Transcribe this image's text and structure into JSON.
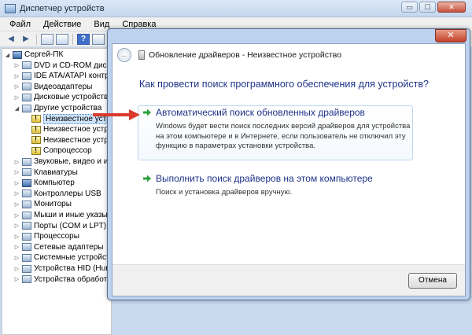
{
  "device_manager": {
    "title": "Диспетчер устройств",
    "window_buttons": [
      "▭",
      "☐",
      "✕"
    ],
    "menu": [
      "Файл",
      "Действие",
      "Вид",
      "Справка"
    ],
    "tree": [
      {
        "label": "Сергей-ПК",
        "expander": "◢",
        "icon": "computer-icon",
        "indent": 0
      },
      {
        "label": "DVD и CD-ROM дисководы",
        "expander": "▷",
        "icon": "dvd-icon",
        "indent": 1
      },
      {
        "label": "IDE ATA/ATAPI контроллеры",
        "expander": "▷",
        "icon": "ide-controller-icon",
        "indent": 1
      },
      {
        "label": "Видеоадаптеры",
        "expander": "▷",
        "icon": "display-adapter-icon",
        "indent": 1
      },
      {
        "label": "Дисковые устройства",
        "expander": "▷",
        "icon": "disk-drive-icon",
        "indent": 1
      },
      {
        "label": "Другие устройства",
        "expander": "◢",
        "icon": "other-devices-icon",
        "indent": 1
      },
      {
        "label": "Неизвестное устройство",
        "expander": "",
        "icon": "warning-device-icon",
        "indent": 2,
        "selected": true
      },
      {
        "label": "Неизвестное устройство",
        "expander": "",
        "icon": "warning-device-icon",
        "indent": 2
      },
      {
        "label": "Неизвестное устройство",
        "expander": "",
        "icon": "warning-device-icon",
        "indent": 2
      },
      {
        "label": "Сопроцессор",
        "expander": "",
        "icon": "warning-device-icon",
        "indent": 2
      },
      {
        "label": "Звуковые, видео и игровые устройства",
        "expander": "▷",
        "icon": "sound-icon",
        "indent": 1
      },
      {
        "label": "Клавиатуры",
        "expander": "▷",
        "icon": "keyboard-icon",
        "indent": 1
      },
      {
        "label": "Компьютер",
        "expander": "▷",
        "icon": "computer-icon",
        "indent": 1
      },
      {
        "label": "Контроллеры USB",
        "expander": "▷",
        "icon": "usb-icon",
        "indent": 1
      },
      {
        "label": "Мониторы",
        "expander": "▷",
        "icon": "monitor-icon",
        "indent": 1
      },
      {
        "label": "Мыши и иные указывающие устройства",
        "expander": "▷",
        "icon": "mouse-icon",
        "indent": 1
      },
      {
        "label": "Порты (COM и LPT)",
        "expander": "▷",
        "icon": "port-icon",
        "indent": 1
      },
      {
        "label": "Процессоры",
        "expander": "▷",
        "icon": "processor-icon",
        "indent": 1
      },
      {
        "label": "Сетевые адаптеры",
        "expander": "▷",
        "icon": "network-adapter-icon",
        "indent": 1
      },
      {
        "label": "Системные устройства",
        "expander": "▷",
        "icon": "system-device-icon",
        "indent": 1
      },
      {
        "label": "Устройства HID (Human Interface Devices)",
        "expander": "▷",
        "icon": "hid-icon",
        "indent": 1
      },
      {
        "label": "Устройства обработки изображений",
        "expander": "▷",
        "icon": "imaging-device-icon",
        "indent": 1
      }
    ]
  },
  "dialog": {
    "close_label": "✕",
    "back_glyph": "←",
    "title": "Обновление драйверов - Неизвестное устройство",
    "question": "Как провести поиск программного обеспечения для устройств?",
    "options": [
      {
        "title": "Автоматический поиск обновленных драйверов",
        "description": "Windows будет вести поиск последних версий драйверов для устройства на этом компьютере и в Интернете, если пользователь не отключил эту функцию в параметрах установки устройства."
      },
      {
        "title": "Выполнить поиск драйверов на этом компьютере",
        "description": "Поиск и установка драйверов вручную."
      }
    ],
    "cancel_label": "Отмена"
  },
  "colors": {
    "accent_text": "#1e3287",
    "option_arrow": "#2aa33a",
    "annotation_arrow": "#d93a2b"
  }
}
